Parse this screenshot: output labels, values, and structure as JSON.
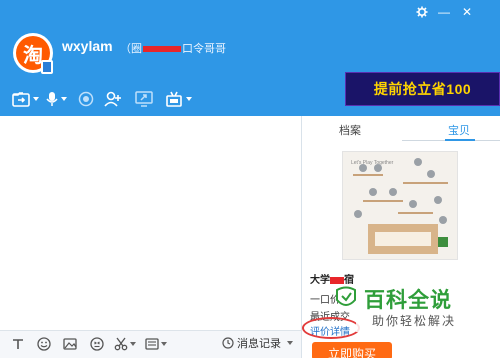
{
  "header": {
    "avatar_char": "淘",
    "username": "wxylam",
    "subtitle_prefix": "（圈",
    "subtitle_suffix": "口令哥哥",
    "settings_icon": "gear-icon",
    "minimize_glyph": "—",
    "close_glyph": "✕"
  },
  "toolbar": {
    "icons": [
      "folder-transfer-icon",
      "microphone-icon",
      "voice-icon",
      "add-contact-icon",
      "screen-share-icon",
      "remote-assist-icon"
    ]
  },
  "ad": {
    "text": "提前抢立省100"
  },
  "input_toolbar": {
    "icons": [
      "font-icon",
      "emoji-icon",
      "image-icon",
      "shake-icon",
      "scissors-icon",
      "keyboard-icon"
    ],
    "history_label": "消息记录"
  },
  "right_panel": {
    "tab_profile": "档案",
    "tab_product": "宝贝",
    "product_title_prefix": "大学",
    "product_title_suffix": "宿",
    "price_label": "一口价：",
    "recent_label": "最近成交",
    "price_detail_link": "评价详情",
    "buy_button": "立即购买",
    "image_caption": "Let's Play Together"
  },
  "watermark": {
    "title": "百科全说",
    "subtitle": "助你轻松解决"
  },
  "colors": {
    "titlebar": "#2f97e6",
    "ad_bg": "#1a1468",
    "ad_text": "#ffd400",
    "buy_button": "#ff6a13",
    "watermark_green": "#2f9e3a"
  }
}
